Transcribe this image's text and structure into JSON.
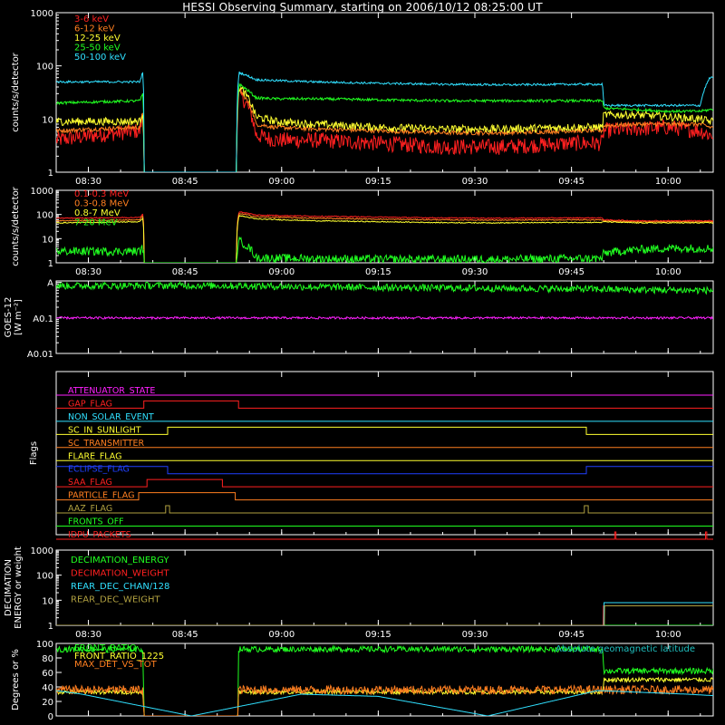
{
  "title": "HESSI Observing Summary, starting on 2006/10/12 08:25:00 UT",
  "colors": {
    "red": "#ff2020",
    "orange": "#ff7f20",
    "yellow": "#ffff30",
    "green": "#20ff20",
    "cyan": "#30e0ff",
    "magenta": "#ff20ff",
    "blue": "#2040ff",
    "olive": "#b0a040",
    "white": "#ffffff",
    "teal": "#20c0c0"
  },
  "time_axis": {
    "ticks": [
      "08:30",
      "08:45",
      "09:00",
      "09:15",
      "09:30",
      "09:45",
      "10:00"
    ],
    "tick_minutes": [
      5,
      20,
      35,
      50,
      65,
      80,
      95
    ],
    "range_minutes": [
      0,
      102
    ]
  },
  "chart_data": [
    {
      "type": "line",
      "id": "lightcurves",
      "ylabel": "counts/s/detector",
      "yscale": "log",
      "ylim": [
        1,
        1000
      ],
      "yticklabels": [
        "1",
        "10",
        "100",
        "1000"
      ],
      "yticks": [
        1,
        10,
        100,
        1000
      ],
      "series": [
        {
          "name": "3-6 keV",
          "color": "red",
          "noise": 0.3,
          "min": 1,
          "x": [
            0,
            13,
            13.5,
            13.6,
            28,
            28.4,
            31,
            34,
            40,
            50,
            60,
            70,
            80,
            84.8,
            85,
            90,
            95,
            100,
            101.5,
            102
          ],
          "y": [
            4,
            6,
            12,
            1,
            1,
            30,
            5,
            4,
            4,
            3.5,
            3,
            3,
            3.5,
            3.5,
            6,
            6.5,
            7,
            6,
            5,
            5
          ]
        },
        {
          "name": "6-12 keV",
          "color": "orange",
          "noise": 0.08,
          "min": 1,
          "x": [
            0,
            13,
            13.5,
            13.6,
            28,
            28.4,
            31,
            34,
            40,
            50,
            60,
            70,
            80,
            84.8,
            85,
            90,
            95,
            100,
            101.5,
            102
          ],
          "y": [
            6,
            7,
            14,
            1,
            1,
            35,
            8,
            7,
            6.5,
            6,
            5.5,
            5.5,
            6,
            6,
            7.5,
            8,
            8,
            8,
            7,
            7
          ]
        },
        {
          "name": "12-25 keV",
          "color": "yellow",
          "noise": 0.15,
          "min": 1,
          "x": [
            0,
            13,
            13.5,
            13.6,
            28,
            28.4,
            31,
            34,
            40,
            50,
            60,
            70,
            80,
            84.8,
            85,
            90,
            95,
            100,
            101.5,
            102
          ],
          "y": [
            9,
            9,
            14,
            1,
            1,
            40,
            11,
            9,
            8,
            7,
            6.5,
            6.5,
            7,
            7,
            12,
            12,
            11,
            10,
            9,
            9
          ]
        },
        {
          "name": "25-50 keV",
          "color": "green",
          "noise": 0.05,
          "min": 1,
          "x": [
            0,
            13,
            13.5,
            13.6,
            28,
            28.4,
            31,
            34,
            40,
            50,
            60,
            70,
            80,
            84.8,
            85,
            90,
            95,
            100,
            101.5,
            102
          ],
          "y": [
            20,
            22,
            30,
            1,
            1,
            45,
            25,
            24,
            24,
            23,
            22,
            22,
            22,
            22,
            16,
            15,
            14,
            14,
            15,
            15
          ]
        },
        {
          "name": "50-100 keV",
          "color": "cyan",
          "noise": 0.04,
          "min": 1,
          "x": [
            0,
            13,
            13.5,
            13.6,
            28,
            28.4,
            31,
            34,
            40,
            50,
            60,
            70,
            80,
            84.8,
            85,
            90,
            95,
            100,
            101.5,
            102
          ],
          "y": [
            50,
            50,
            80,
            1,
            1,
            75,
            55,
            53,
            50,
            47,
            45,
            44,
            45,
            45,
            18,
            18,
            18,
            18,
            60,
            60
          ]
        }
      ]
    },
    {
      "type": "line",
      "id": "high-energy",
      "ylabel": "counts/s/detector",
      "yscale": "log",
      "ylim": [
        1,
        1000
      ],
      "yticklabels": [
        "1",
        "10",
        "100",
        "1000"
      ],
      "yticks": [
        1,
        10,
        100,
        1000
      ],
      "series": [
        {
          "name": "0.1-0.3 MeV",
          "color": "red",
          "noise": 0.04,
          "min": 1,
          "x": [
            0,
            13,
            13.5,
            13.6,
            28,
            28.4,
            31,
            40,
            50,
            60,
            70,
            80,
            84.8,
            85,
            90,
            95,
            100,
            102
          ],
          "y": [
            70,
            75,
            110,
            1,
            1,
            130,
            95,
            85,
            78,
            72,
            70,
            72,
            72,
            60,
            55,
            55,
            55,
            55
          ]
        },
        {
          "name": "0.3-0.8 MeV",
          "color": "orange",
          "noise": 0.04,
          "min": 1,
          "x": [
            0,
            13,
            13.5,
            13.6,
            28,
            28.4,
            31,
            40,
            50,
            60,
            70,
            80,
            84.8,
            85,
            90,
            95,
            100,
            102
          ],
          "y": [
            55,
            60,
            90,
            1,
            1,
            110,
            80,
            70,
            64,
            60,
            58,
            60,
            60,
            55,
            50,
            50,
            50,
            50
          ]
        },
        {
          "name": "0.8-7 MeV",
          "color": "yellow",
          "noise": 0.04,
          "min": 1,
          "x": [
            0,
            13,
            13.5,
            13.6,
            28,
            28.4,
            31,
            40,
            50,
            60,
            70,
            80,
            84.8,
            85,
            90,
            95,
            100,
            102
          ],
          "y": [
            45,
            50,
            75,
            1,
            1,
            90,
            65,
            55,
            50,
            46,
            45,
            47,
            47,
            50,
            45,
            45,
            45,
            45
          ]
        },
        {
          "name": "7-20 MeV",
          "color": "green",
          "noise": 0.35,
          "min": 1,
          "x": [
            0,
            13,
            13.5,
            13.6,
            28,
            28.4,
            31,
            40,
            50,
            60,
            70,
            80,
            84.8,
            85,
            90,
            95,
            100,
            102
          ],
          "y": [
            3,
            3,
            4,
            1,
            1,
            8,
            1.6,
            1.5,
            1.4,
            1.4,
            1.4,
            1.5,
            1.5,
            2.5,
            3.5,
            4,
            4,
            4
          ]
        }
      ]
    },
    {
      "type": "line",
      "id": "goes",
      "ylabel": "GOES-12",
      "ylabel2": "[W m⁻²]",
      "yscale": "log",
      "ylim": [
        0.01,
        1.1
      ],
      "yticklabels": [
        "A0.01",
        "A0.1",
        "A"
      ],
      "yticks": [
        0.01,
        0.1,
        1
      ],
      "series": [
        {
          "name": "",
          "color": "green",
          "noise": 0.2,
          "min": 0.01,
          "x": [
            0,
            20,
            30,
            40,
            50,
            60,
            70,
            80,
            90,
            100,
            102
          ],
          "y": [
            0.8,
            0.82,
            0.8,
            0.75,
            0.72,
            0.7,
            0.68,
            0.66,
            0.62,
            0.6,
            0.6
          ]
        },
        {
          "name": "",
          "color": "magenta",
          "noise": 0.06,
          "min": 0.01,
          "x": [
            0,
            102
          ],
          "y": [
            0.1,
            0.1
          ]
        }
      ]
    },
    {
      "type": "step",
      "id": "flags",
      "ylabel": "Flags",
      "flags": [
        {
          "name": "ATTENUATOR_STATE",
          "color": "magenta",
          "x": [
            0,
            102
          ],
          "y": [
            0,
            0
          ]
        },
        {
          "name": "GAP_FLAG",
          "color": "red",
          "x": [
            0,
            13.6,
            13.6,
            28.3,
            28.3,
            102
          ],
          "y": [
            0,
            0,
            1,
            1,
            0,
            0
          ]
        },
        {
          "name": "NON_SOLAR_EVENT",
          "color": "cyan",
          "x": [
            0,
            102
          ],
          "y": [
            0,
            0
          ]
        },
        {
          "name": "SC_IN_SUNLIGHT",
          "color": "yellow",
          "x": [
            0,
            17.3,
            17.3,
            82.3,
            82.3,
            102
          ],
          "y": [
            0,
            0,
            1,
            1,
            0,
            0
          ]
        },
        {
          "name": "SC_TRANSMITTER",
          "color": "orange",
          "x": [
            0,
            102
          ],
          "y": [
            0,
            0
          ]
        },
        {
          "name": "FLARE_FLAG",
          "color": "yellow",
          "x": [
            0,
            102
          ],
          "y": [
            0,
            0
          ]
        },
        {
          "name": "ECLIPSE_FLAG",
          "color": "blue",
          "x": [
            0,
            17.3,
            17.3,
            82.3,
            82.3,
            102
          ],
          "y": [
            1,
            1,
            0,
            0,
            1,
            1
          ]
        },
        {
          "name": "SAA_FLAG",
          "color": "red",
          "x": [
            0,
            14.1,
            14.1,
            25.8,
            25.8,
            102
          ],
          "y": [
            0,
            0,
            1,
            1,
            0,
            0
          ]
        },
        {
          "name": "PARTICLE_FLAG",
          "color": "orange",
          "x": [
            0,
            12.8,
            12.8,
            27.8,
            27.8,
            102
          ],
          "y": [
            0,
            0,
            1,
            1,
            0,
            0
          ]
        },
        {
          "name": "AAZ_FLAG",
          "color": "olive",
          "x": [
            0,
            17.0,
            17.0,
            17.6,
            17.6,
            82.0,
            82.0,
            82.6,
            82.6,
            102
          ],
          "y": [
            0,
            0,
            1,
            1,
            0,
            0,
            1,
            1,
            0,
            0
          ]
        },
        {
          "name": "FRONTS_OFF",
          "color": "green",
          "x": [
            0,
            102
          ],
          "y": [
            0,
            0
          ]
        },
        {
          "name": "IDPU_PACKETS",
          "color": "red",
          "x": [
            0,
            86.7,
            86.7,
            86.9,
            86.9,
            100.8,
            100.8,
            101.0,
            101.0,
            102
          ],
          "y": [
            0,
            0,
            1,
            1,
            0,
            0,
            1,
            1,
            0,
            0
          ]
        }
      ]
    },
    {
      "type": "line",
      "id": "decimation",
      "ylabel": "DECIMATION",
      "ylabel2": "ENERGY or weight",
      "yscale": "log",
      "ylim": [
        1,
        1000
      ],
      "yticklabels": [
        "1",
        "10",
        "100",
        "1000"
      ],
      "yticks": [
        1,
        10,
        100,
        1000
      ],
      "series": [
        {
          "name": "DECIMATION_ENERGY",
          "color": "green",
          "noise": 0,
          "min": 1,
          "x": [
            0,
            102
          ],
          "y": [
            1,
            1
          ]
        },
        {
          "name": "DECIMATION_WEIGHT",
          "color": "red",
          "noise": 0,
          "min": 1,
          "x": [
            0,
            84.9,
            84.9,
            102
          ],
          "y": [
            1,
            1,
            6,
            6
          ]
        },
        {
          "name": "REAR_DEC_CHAN/128",
          "color": "cyan",
          "noise": 0,
          "min": 1,
          "x": [
            0,
            85,
            85,
            102
          ],
          "y": [
            1,
            1,
            8,
            8
          ]
        },
        {
          "name": "REAR_DEC_WEIGHT",
          "color": "olive",
          "noise": 0,
          "min": 1,
          "x": [
            0,
            85.1,
            85.1,
            102
          ],
          "y": [
            1,
            1,
            6,
            6
          ]
        }
      ]
    },
    {
      "type": "line",
      "id": "ratios",
      "ylabel": "Degrees or %",
      "yscale": "linear",
      "ylim": [
        0,
        100
      ],
      "yticklabels": [
        "0",
        "20",
        "40",
        "60",
        "80",
        "100"
      ],
      "yticks": [
        0,
        20,
        40,
        60,
        80,
        100
      ],
      "annotation": "Absolute geomagnetic latitude",
      "series": [
        {
          "name": "FRONT_RATIO",
          "color": "green",
          "noise": 4,
          "min": 0,
          "x": [
            0,
            13.5,
            13.6,
            28.2,
            28.3,
            84.9,
            85,
            102
          ],
          "y": [
            92,
            92,
            0,
            0,
            92,
            92,
            62,
            62
          ]
        },
        {
          "name": "FRONT_RATIO_1225",
          "color": "yellow",
          "noise": 3,
          "min": 0,
          "x": [
            0,
            13.5,
            13.6,
            28.2,
            28.3,
            84.9,
            85,
            102
          ],
          "y": [
            33,
            33,
            0,
            0,
            33,
            33,
            50,
            50
          ]
        },
        {
          "name": "MAX_DET_VS_TOT",
          "color": "orange",
          "noise": 6,
          "min": 0,
          "x": [
            0,
            13.5,
            13.6,
            28.2,
            28.3,
            84.9,
            85,
            102
          ],
          "y": [
            36,
            36,
            0,
            0,
            36,
            36,
            36,
            36
          ]
        },
        {
          "name": "",
          "color": "cyan",
          "noise": 0,
          "min": 0,
          "x": [
            0,
            4,
            21,
            38,
            50,
            67,
            84,
            98,
            102
          ],
          "y": [
            35,
            30,
            0,
            30,
            27,
            0,
            35,
            30,
            28
          ]
        }
      ]
    }
  ]
}
